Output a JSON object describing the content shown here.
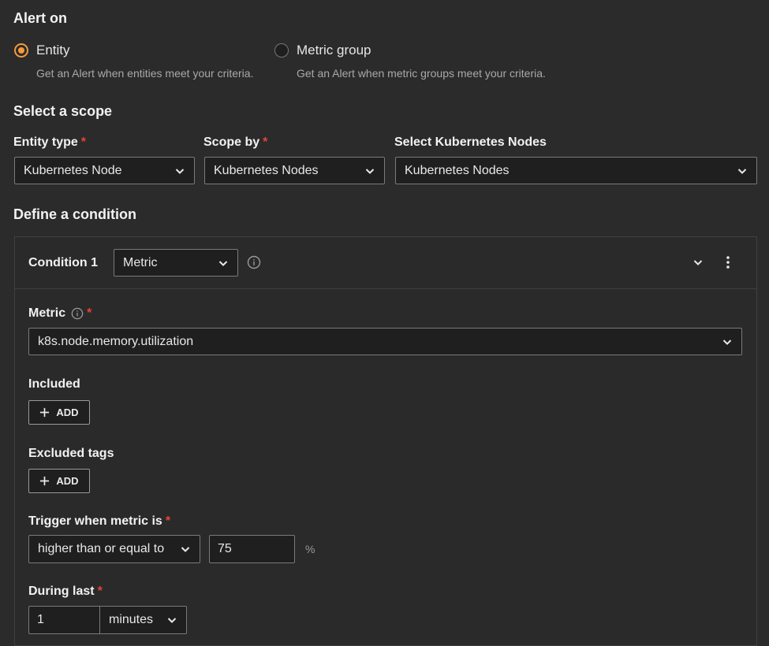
{
  "alert_on": {
    "heading": "Alert on",
    "options": [
      {
        "label": "Entity",
        "description": "Get an Alert when entities meet your criteria.",
        "selected": true
      },
      {
        "label": "Metric group",
        "description": "Get an Alert when metric groups meet your criteria.",
        "selected": false
      }
    ]
  },
  "scope": {
    "heading": "Select a scope",
    "entity_type": {
      "label": "Entity type",
      "required": "*",
      "value": "Kubernetes Node"
    },
    "scope_by": {
      "label": "Scope by",
      "required": "*",
      "value": "Kubernetes Nodes"
    },
    "select_nodes": {
      "label": "Select Kubernetes Nodes",
      "value": "Kubernetes Nodes"
    }
  },
  "condition_section": {
    "heading": "Define a condition",
    "condition": {
      "title": "Condition 1",
      "type_value": "Metric",
      "metric": {
        "label": "Metric",
        "required": "*",
        "value": "k8s.node.memory.utilization"
      },
      "included": {
        "label": "Included",
        "add_label": "ADD"
      },
      "excluded": {
        "label": "Excluded tags",
        "add_label": "ADD"
      },
      "trigger": {
        "label": "Trigger when metric is",
        "required": "*",
        "operator": "higher than or equal to",
        "threshold": "75",
        "unit": "%"
      },
      "during": {
        "label": "During last",
        "required": "*",
        "amount": "1",
        "unit": "minutes"
      }
    }
  },
  "colors": {
    "accent": "#f59a3a",
    "required": "#e0453a",
    "background": "#2b2b2b",
    "field": "#1f1f1f"
  }
}
